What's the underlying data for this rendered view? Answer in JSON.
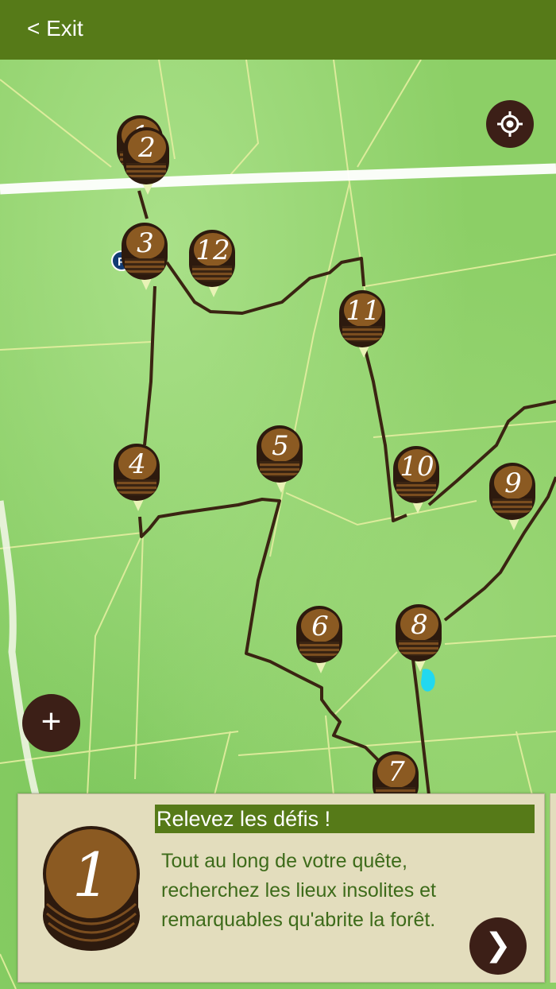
{
  "header": {
    "exit_label": "< Exit"
  },
  "map": {
    "parking_label": "P",
    "markers": [
      {
        "num": "1"
      },
      {
        "num": "2"
      },
      {
        "num": "3"
      },
      {
        "num": "12"
      },
      {
        "num": "11"
      },
      {
        "num": "4"
      },
      {
        "num": "5"
      },
      {
        "num": "10"
      },
      {
        "num": "9"
      },
      {
        "num": "6"
      },
      {
        "num": "8"
      },
      {
        "num": "7"
      }
    ],
    "zoom_label": "+"
  },
  "card": {
    "barrel_number": "1",
    "title": "Relevez les défis !",
    "description": "Tout au long de votre quête, recherchez les lieux insolites et remarquables qu'abrite la forêt.",
    "next_label": "❯"
  },
  "colors": {
    "header_bg": "#567a18",
    "card_bg": "#e3ddbd",
    "button_bg": "#3c1f17",
    "text_green": "#3d6b1a"
  },
  "icons": {
    "locate": "locate-crosshair-icon",
    "zoom": "plus-icon",
    "next": "chevron-right-icon"
  }
}
